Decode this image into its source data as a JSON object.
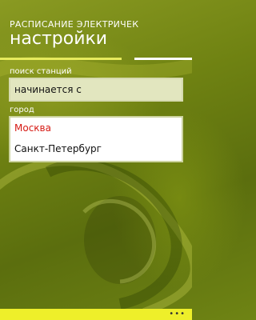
{
  "header": {
    "app_title": "РАСПИСАНИЕ ЭЛЕКТРИЧЕК",
    "page_title": "настройки"
  },
  "search": {
    "label": "поиск станций",
    "value": "начинается с"
  },
  "city": {
    "label": "город",
    "options": [
      "Москва",
      "Санкт-Петербург"
    ],
    "selected": "Москва"
  },
  "app_bar": {
    "more_label": "•••"
  },
  "colors": {
    "accent": "#e6ea5e",
    "selected_text": "#d61a14",
    "app_bar": "#eeef2a"
  }
}
